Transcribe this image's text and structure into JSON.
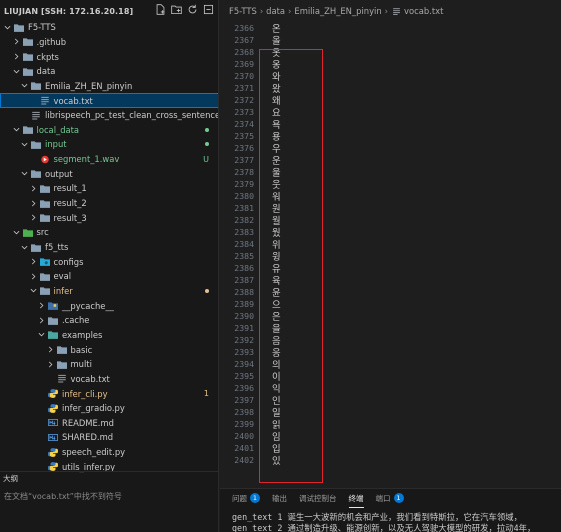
{
  "sidebar": {
    "workspace_title": "LIUJIAN [SSH: 172.16.20.18]",
    "actions": [
      "new-file-icon",
      "new-folder-icon",
      "refresh-icon",
      "collapse-all-icon"
    ],
    "tree": [
      {
        "label": "F5-TTS",
        "depth": 0,
        "type": "folder",
        "open": true,
        "color": "",
        "badge": ""
      },
      {
        "label": ".github",
        "depth": 1,
        "type": "folder",
        "open": false,
        "color": "",
        "badge": ""
      },
      {
        "label": "ckpts",
        "depth": 1,
        "type": "folder",
        "open": false,
        "color": "",
        "badge": ""
      },
      {
        "label": "data",
        "depth": 1,
        "type": "folder",
        "open": true,
        "color": "",
        "badge": ""
      },
      {
        "label": "Emilia_ZH_EN_pinyin",
        "depth": 2,
        "type": "folder",
        "open": true,
        "color": "",
        "badge": ""
      },
      {
        "label": "vocab.txt",
        "depth": 3,
        "type": "txt",
        "open": false,
        "color": "",
        "badge": "",
        "selected": true
      },
      {
        "label": "librispeech_pc_test_clean_cross_sentence.lst",
        "depth": 2,
        "type": "txt",
        "open": false,
        "color": "",
        "badge": ""
      },
      {
        "label": "local_data",
        "depth": 1,
        "type": "folder",
        "open": true,
        "color": "green",
        "badge": "dot"
      },
      {
        "label": "input",
        "depth": 2,
        "type": "folder",
        "open": true,
        "color": "green",
        "badge": "dot"
      },
      {
        "label": "segment_1.wav",
        "depth": 3,
        "type": "wav",
        "open": false,
        "color": "green",
        "badge": "U"
      },
      {
        "label": "output",
        "depth": 2,
        "type": "folder",
        "open": true,
        "color": "",
        "badge": ""
      },
      {
        "label": "result_1",
        "depth": 3,
        "type": "folder",
        "open": false,
        "color": "",
        "badge": ""
      },
      {
        "label": "result_2",
        "depth": 3,
        "type": "folder",
        "open": false,
        "color": "",
        "badge": ""
      },
      {
        "label": "result_3",
        "depth": 3,
        "type": "folder",
        "open": false,
        "color": "",
        "badge": ""
      },
      {
        "label": "src",
        "depth": 1,
        "type": "src",
        "open": true,
        "color": "",
        "badge": ""
      },
      {
        "label": "f5_tts",
        "depth": 2,
        "type": "folder",
        "open": true,
        "color": "",
        "badge": ""
      },
      {
        "label": "configs",
        "depth": 3,
        "type": "config",
        "open": false,
        "color": "",
        "badge": ""
      },
      {
        "label": "eval",
        "depth": 3,
        "type": "folder",
        "open": false,
        "color": "",
        "badge": ""
      },
      {
        "label": "infer",
        "depth": 3,
        "type": "folder",
        "open": true,
        "color": "yellow",
        "badge": "dot-yellow"
      },
      {
        "label": "__pycache__",
        "depth": 4,
        "type": "pycache",
        "open": false,
        "color": "",
        "badge": ""
      },
      {
        "label": ".cache",
        "depth": 4,
        "type": "folder",
        "open": false,
        "color": "",
        "badge": ""
      },
      {
        "label": "examples",
        "depth": 4,
        "type": "examples",
        "open": true,
        "color": "",
        "badge": ""
      },
      {
        "label": "basic",
        "depth": 5,
        "type": "folder",
        "open": false,
        "color": "",
        "badge": ""
      },
      {
        "label": "multi",
        "depth": 5,
        "type": "folder",
        "open": false,
        "color": "",
        "badge": ""
      },
      {
        "label": "vocab.txt",
        "depth": 5,
        "type": "txt",
        "open": false,
        "color": "",
        "badge": "",
        "nochev": true
      },
      {
        "label": "infer_cli.py",
        "depth": 4,
        "type": "py",
        "open": false,
        "color": "yellow",
        "badge": "1",
        "nochev": true
      },
      {
        "label": "infer_gradio.py",
        "depth": 4,
        "type": "py",
        "open": false,
        "color": "",
        "badge": "",
        "nochev": true
      },
      {
        "label": "README.md",
        "depth": 4,
        "type": "md",
        "open": false,
        "color": "",
        "badge": "",
        "nochev": true
      },
      {
        "label": "SHARED.md",
        "depth": 4,
        "type": "md",
        "open": false,
        "color": "",
        "badge": "",
        "nochev": true
      },
      {
        "label": "speech_edit.py",
        "depth": 4,
        "type": "py",
        "open": false,
        "color": "",
        "badge": "",
        "nochev": true
      },
      {
        "label": "utils_infer.py",
        "depth": 4,
        "type": "py",
        "open": false,
        "color": "",
        "badge": "",
        "nochev": true
      }
    ],
    "outline_title": "大纲",
    "outline_message": "在文档“vocab.txt”中找不到符号"
  },
  "editor": {
    "breadcrumb": [
      "F5-TTS",
      "data",
      "Emilia_ZH_EN_pinyin",
      "vocab.txt"
    ],
    "lines": [
      {
        "n": "2366",
        "t": "온"
      },
      {
        "n": "2367",
        "t": "올"
      },
      {
        "n": "2368",
        "t": "옷"
      },
      {
        "n": "2369",
        "t": "옹"
      },
      {
        "n": "2370",
        "t": "와"
      },
      {
        "n": "2371",
        "t": "왔"
      },
      {
        "n": "2372",
        "t": "왜"
      },
      {
        "n": "2373",
        "t": "요"
      },
      {
        "n": "2374",
        "t": "욕"
      },
      {
        "n": "2375",
        "t": "용"
      },
      {
        "n": "2376",
        "t": "우"
      },
      {
        "n": "2377",
        "t": "운"
      },
      {
        "n": "2378",
        "t": "울"
      },
      {
        "n": "2379",
        "t": "웃"
      },
      {
        "n": "2380",
        "t": "워"
      },
      {
        "n": "2381",
        "t": "원"
      },
      {
        "n": "2382",
        "t": "월"
      },
      {
        "n": "2383",
        "t": "웠"
      },
      {
        "n": "2384",
        "t": "위"
      },
      {
        "n": "2385",
        "t": "윙"
      },
      {
        "n": "2386",
        "t": "유"
      },
      {
        "n": "2387",
        "t": "육"
      },
      {
        "n": "2388",
        "t": "윤"
      },
      {
        "n": "2389",
        "t": "으"
      },
      {
        "n": "2390",
        "t": "은"
      },
      {
        "n": "2391",
        "t": "을"
      },
      {
        "n": "2392",
        "t": "음"
      },
      {
        "n": "2393",
        "t": "응"
      },
      {
        "n": "2394",
        "t": "의"
      },
      {
        "n": "2395",
        "t": "이"
      },
      {
        "n": "2396",
        "t": "익"
      },
      {
        "n": "2397",
        "t": "인"
      },
      {
        "n": "2398",
        "t": "일"
      },
      {
        "n": "2399",
        "t": "읽"
      },
      {
        "n": "2400",
        "t": "임"
      },
      {
        "n": "2401",
        "t": "입"
      },
      {
        "n": "2402",
        "t": "있"
      }
    ]
  },
  "panel": {
    "tabs": [
      {
        "label": "问题",
        "count": "1",
        "active": false
      },
      {
        "label": "输出",
        "count": "",
        "active": false
      },
      {
        "label": "调试控制台",
        "count": "",
        "active": false
      },
      {
        "label": "终端",
        "count": "",
        "active": true
      },
      {
        "label": "端口",
        "count": "1",
        "active": false
      }
    ],
    "terminal_lines": [
      "gen_text 1 诞生一大波新的机会和产业，我们看到特斯拉，它在汽车领域，",
      "gen_text 2 通过制造升级、能源创新，以及无人驾驶大模型的研发，拉动4年，"
    ]
  },
  "colors": {
    "accent": "#0078d4",
    "git_untracked": "#73c991",
    "git_modified": "#e2c08d",
    "highlight_box": "#e0242a"
  }
}
